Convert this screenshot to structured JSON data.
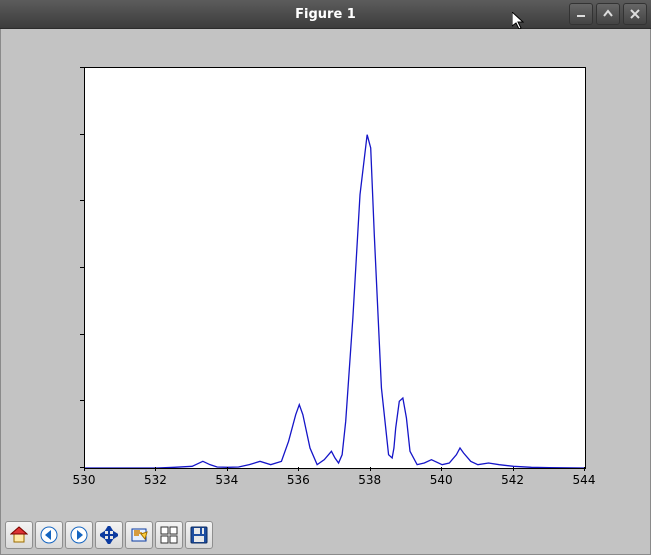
{
  "window": {
    "title": "Figure 1",
    "minimize_tooltip": "Minimize",
    "maximize_tooltip": "Maximize",
    "close_tooltip": "Close"
  },
  "toolbar": {
    "home": "Home",
    "back": "Back",
    "forward": "Forward",
    "pan": "Pan",
    "zoom": "Zoom",
    "subplots": "Configure subplots",
    "save": "Save"
  },
  "chart_data": {
    "type": "line",
    "title": "",
    "xlabel": "",
    "ylabel": "",
    "xlim": [
      530,
      544
    ],
    "ylim": [
      0,
      120
    ],
    "xticks": [
      530,
      532,
      534,
      536,
      538,
      540,
      542,
      544
    ],
    "yticks": [
      0,
      20,
      40,
      60,
      80,
      100,
      120
    ],
    "series": [
      {
        "name": "",
        "color": "#1515c8",
        "x": [
          530.0,
          531.0,
          532.0,
          532.5,
          533.0,
          533.1,
          533.3,
          533.5,
          533.7,
          534.0,
          534.3,
          534.6,
          534.9,
          535.2,
          535.5,
          535.7,
          535.9,
          536.0,
          536.1,
          536.3,
          536.5,
          536.7,
          536.9,
          537.0,
          537.1,
          537.2,
          537.3,
          537.5,
          537.7,
          537.9,
          538.0,
          538.1,
          538.3,
          538.5,
          538.6,
          538.65,
          538.7,
          538.8,
          538.9,
          539.0,
          539.1,
          539.3,
          539.5,
          539.7,
          540.0,
          540.2,
          540.4,
          540.5,
          540.6,
          540.8,
          541.0,
          541.3,
          541.6,
          542.0,
          542.5,
          543.0,
          544.0
        ],
        "y": [
          0.0,
          0.0,
          0.0,
          0.2,
          0.5,
          1.0,
          2.0,
          1.0,
          0.3,
          0.2,
          0.3,
          1.0,
          2.0,
          1.0,
          2.0,
          8.0,
          16.0,
          19.0,
          16.0,
          6.0,
          1.0,
          2.5,
          5.0,
          3.0,
          1.5,
          4.0,
          14.0,
          45.0,
          82.0,
          100.0,
          96.0,
          70.0,
          24.0,
          4.0,
          3.0,
          6.0,
          12.0,
          20.0,
          21.0,
          15.0,
          5.0,
          1.0,
          1.5,
          2.5,
          1.0,
          1.5,
          4.0,
          6.0,
          4.5,
          2.0,
          1.0,
          1.5,
          1.0,
          0.5,
          0.2,
          0.1,
          0.0
        ]
      }
    ]
  }
}
